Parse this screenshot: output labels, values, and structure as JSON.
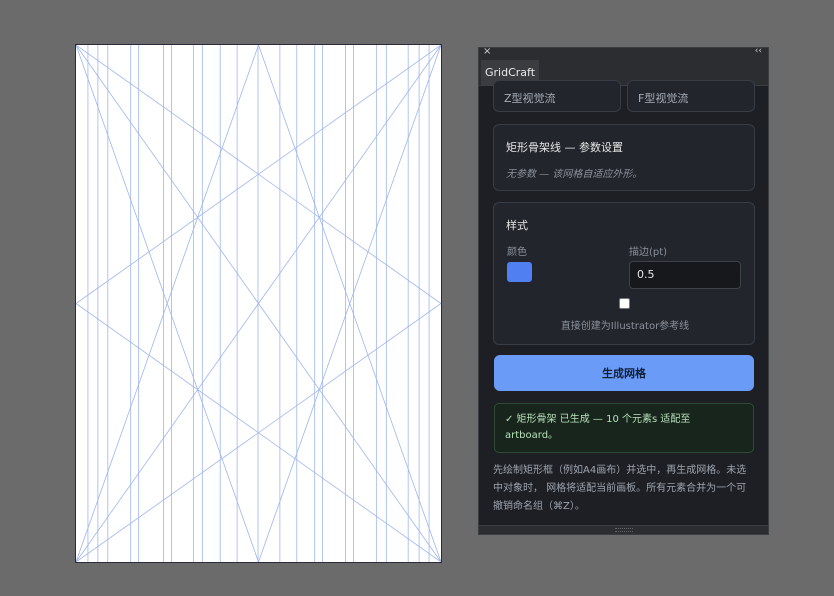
{
  "artboard": {
    "line_color": "#9fb6ea",
    "border_color": "#2a2a3a"
  },
  "panel": {
    "close_glyph": "×",
    "collapse_glyph": "‹‹",
    "tab_label": "GridCraft",
    "flow_buttons": [
      "Z型视觉流",
      "F型视觉流"
    ],
    "params": {
      "title": "矩形骨架线 — 参数设置",
      "note": "无参数 — 该网格自适应外形。"
    },
    "style": {
      "title": "样式",
      "color_label": "颜色",
      "color_value": "#4f7ff0",
      "stroke_label": "描边(pt)",
      "stroke_value": "0.5",
      "guides_checked": false,
      "guides_label": "直接创建为Illustrator参考线"
    },
    "generate": {
      "label": "生成网格",
      "color": "#6a9bf7"
    },
    "status_text": "✓ 矩形骨架 已生成 — 10 个元素s 适配至 artboard。",
    "help_text": "先绘制矩形框（例如A4画布）并选中，再生成网格。未选中对象时， 网格将适配当前画板。所有元素合并为一个可撤销命名组（⌘Z）。"
  }
}
